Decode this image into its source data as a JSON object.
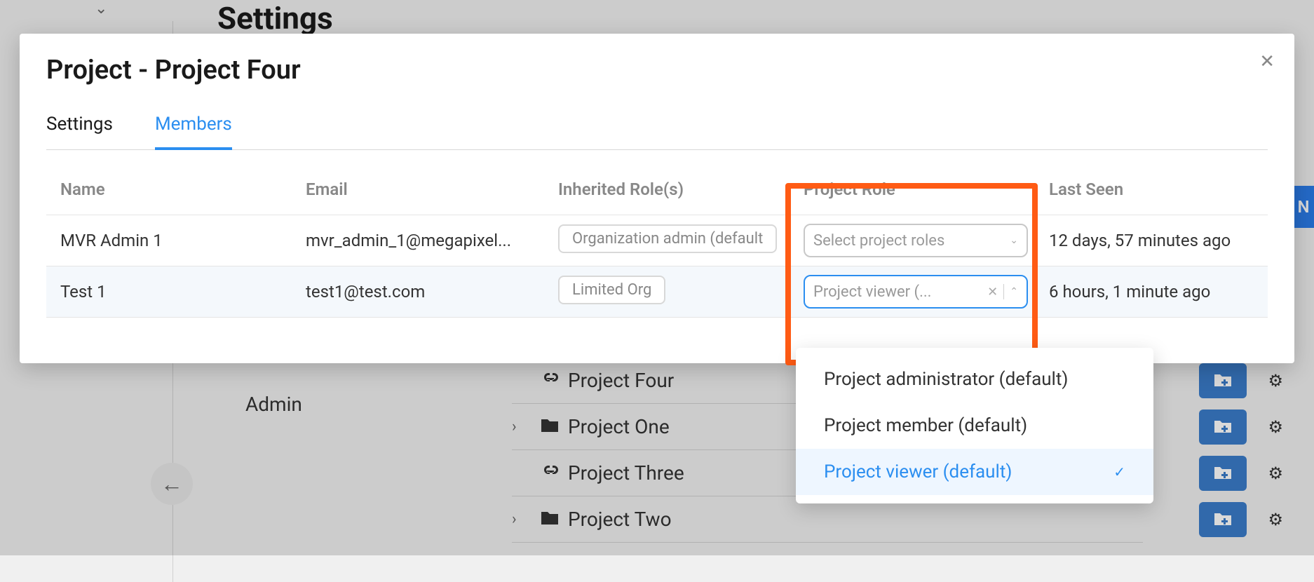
{
  "background": {
    "page_title": "Settings",
    "sidebar_label": "Admin",
    "truncated_button": "N",
    "projects": [
      {
        "label": "Project Four",
        "icon": "link-icon",
        "has_chevron": false
      },
      {
        "label": "Project One",
        "icon": "folder-icon",
        "has_chevron": true
      },
      {
        "label": "Project Three",
        "icon": "link-icon",
        "has_chevron": false
      },
      {
        "label": "Project Two",
        "icon": "folder-icon",
        "has_chevron": true
      }
    ]
  },
  "modal": {
    "title": "Project - Project Four",
    "tabs": [
      {
        "label": "Settings",
        "active": false
      },
      {
        "label": "Members",
        "active": true
      }
    ],
    "columns": {
      "name": "Name",
      "email": "Email",
      "inherited": "Inherited Role(s)",
      "project_role": "Project Role",
      "last_seen": "Last Seen"
    },
    "rows": [
      {
        "name": "MVR Admin 1",
        "email": "mvr_admin_1@megapixel...",
        "inherited_role": "Organization admin (default",
        "project_role_placeholder": "Select project roles",
        "project_role_value": "",
        "last_seen": "12 days, 57 minutes ago",
        "focused": false
      },
      {
        "name": "Test 1",
        "email": "test1@test.com",
        "inherited_role": "Limited Org",
        "project_role_placeholder": "",
        "project_role_value": "Project viewer (...",
        "last_seen": "6 hours, 1 minute ago",
        "focused": true
      }
    ]
  },
  "dropdown": {
    "items": [
      {
        "label": "Project administrator (default)",
        "selected": false
      },
      {
        "label": "Project member (default)",
        "selected": false
      },
      {
        "label": "Project viewer (default)",
        "selected": true
      }
    ]
  }
}
